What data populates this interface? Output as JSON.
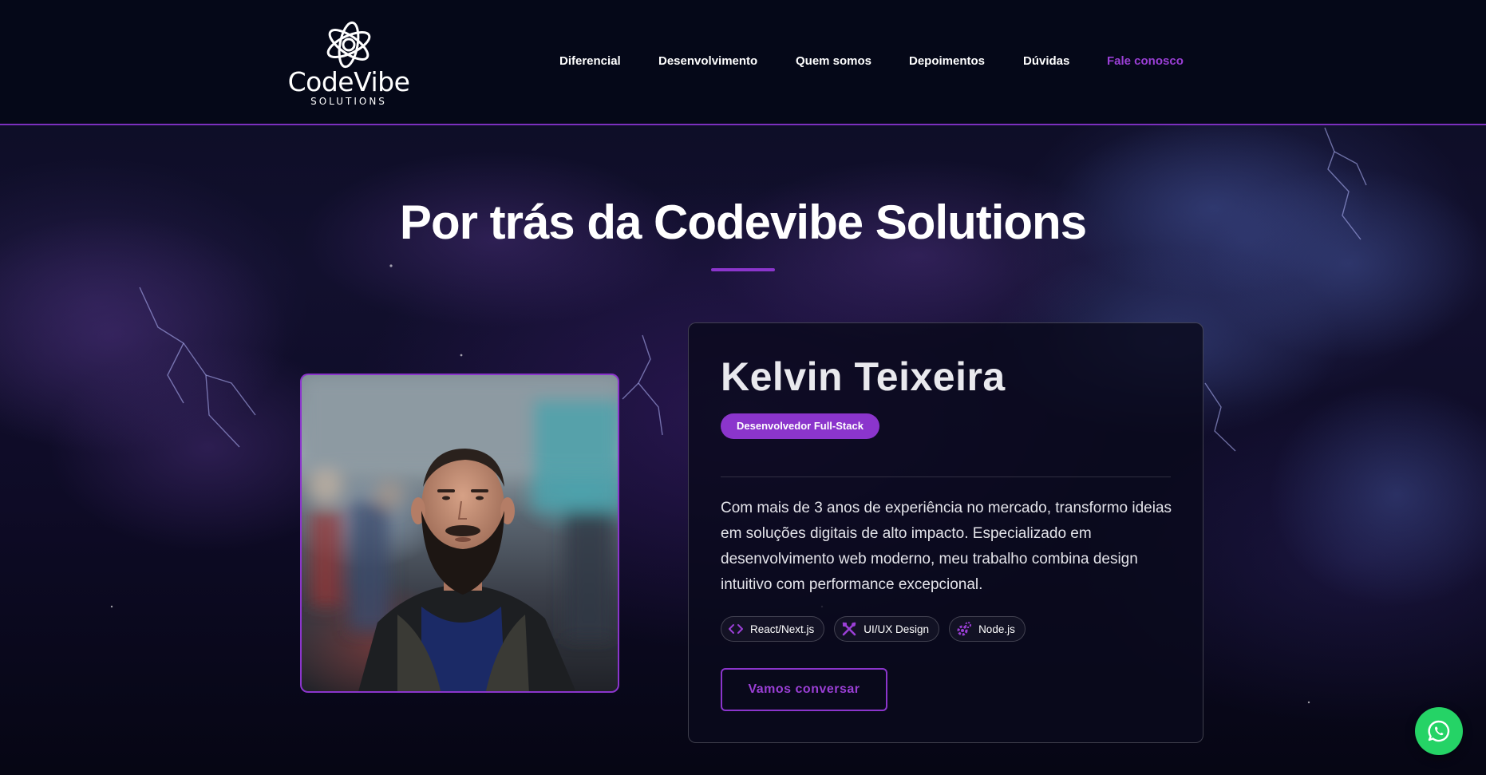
{
  "brand": {
    "name": "CodeVibe",
    "tagline": "SOLUTIONS"
  },
  "nav": {
    "items": [
      {
        "label": "Diferencial"
      },
      {
        "label": "Desenvolvimento"
      },
      {
        "label": "Quem somos"
      },
      {
        "label": "Depoimentos"
      },
      {
        "label": "Dúvidas"
      },
      {
        "label": "Fale conosco"
      }
    ]
  },
  "section": {
    "title": "Por trás da Codevibe Solutions"
  },
  "profile": {
    "name": "Kelvin Teixeira",
    "role": "Desenvolvedor Full-Stack",
    "bio": "Com mais de 3 anos de experiência no mercado, transformo ideias em soluções digitais de alto impacto. Especializado em desenvolvimento web moderno, meu trabalho combina design intuitivo com performance excepcional.",
    "skills": [
      {
        "label": "React/Next.js",
        "icon": "code-icon"
      },
      {
        "label": "UI/UX Design",
        "icon": "design-tools-icon"
      },
      {
        "label": "Node.js",
        "icon": "gears-icon"
      }
    ],
    "cta_label": "Vamos conversar"
  },
  "colors": {
    "accent": "#8b35cc",
    "nav_accent": "#9b3fd6",
    "header_bg": "#050818",
    "whatsapp": "#25d366"
  }
}
